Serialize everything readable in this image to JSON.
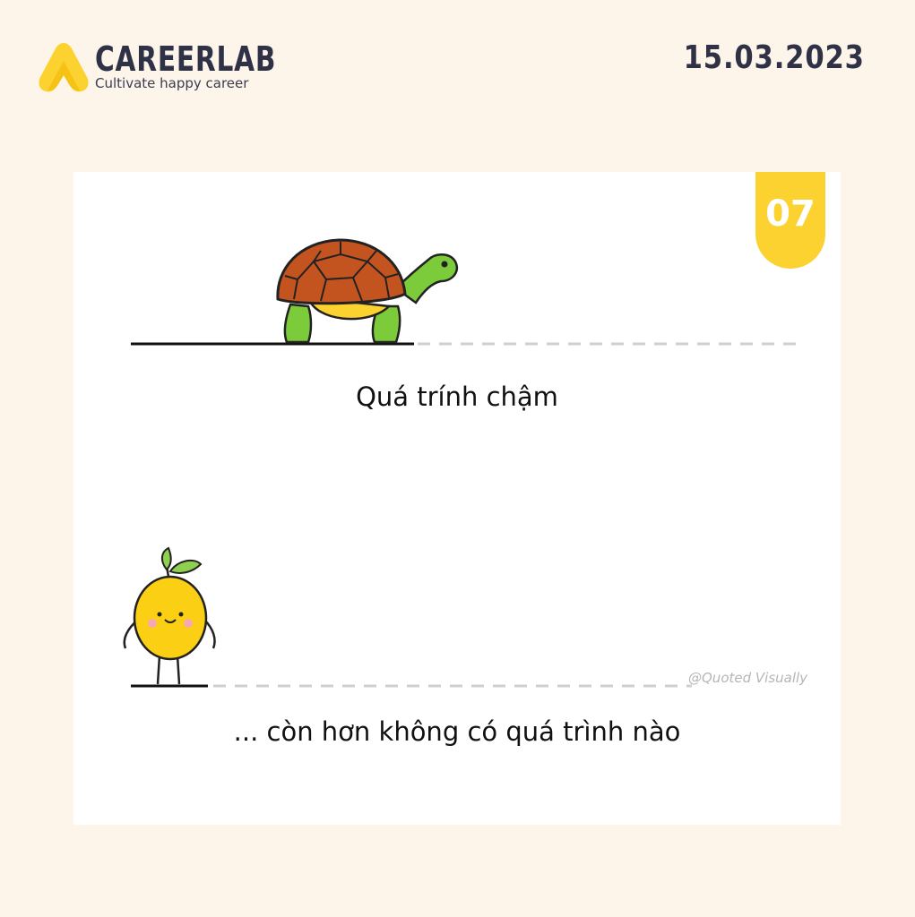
{
  "header": {
    "brand_name": "CAREERLAB",
    "brand_tagline": "Cultivate happy career",
    "date": "15.03.2023"
  },
  "card": {
    "badge_number": "07",
    "caption_top": "Quá trính chậm",
    "caption_bottom": "... còn hơn không có quá trình nào",
    "watermark": "@Quoted Visually"
  },
  "colors": {
    "background": "#fdf5e9",
    "accent_yellow": "#fbd230",
    "text_dark": "#2f3146",
    "turtle_shell": "#c4541f",
    "turtle_skin": "#7ccb3a",
    "lemon": "#fbcf14"
  }
}
